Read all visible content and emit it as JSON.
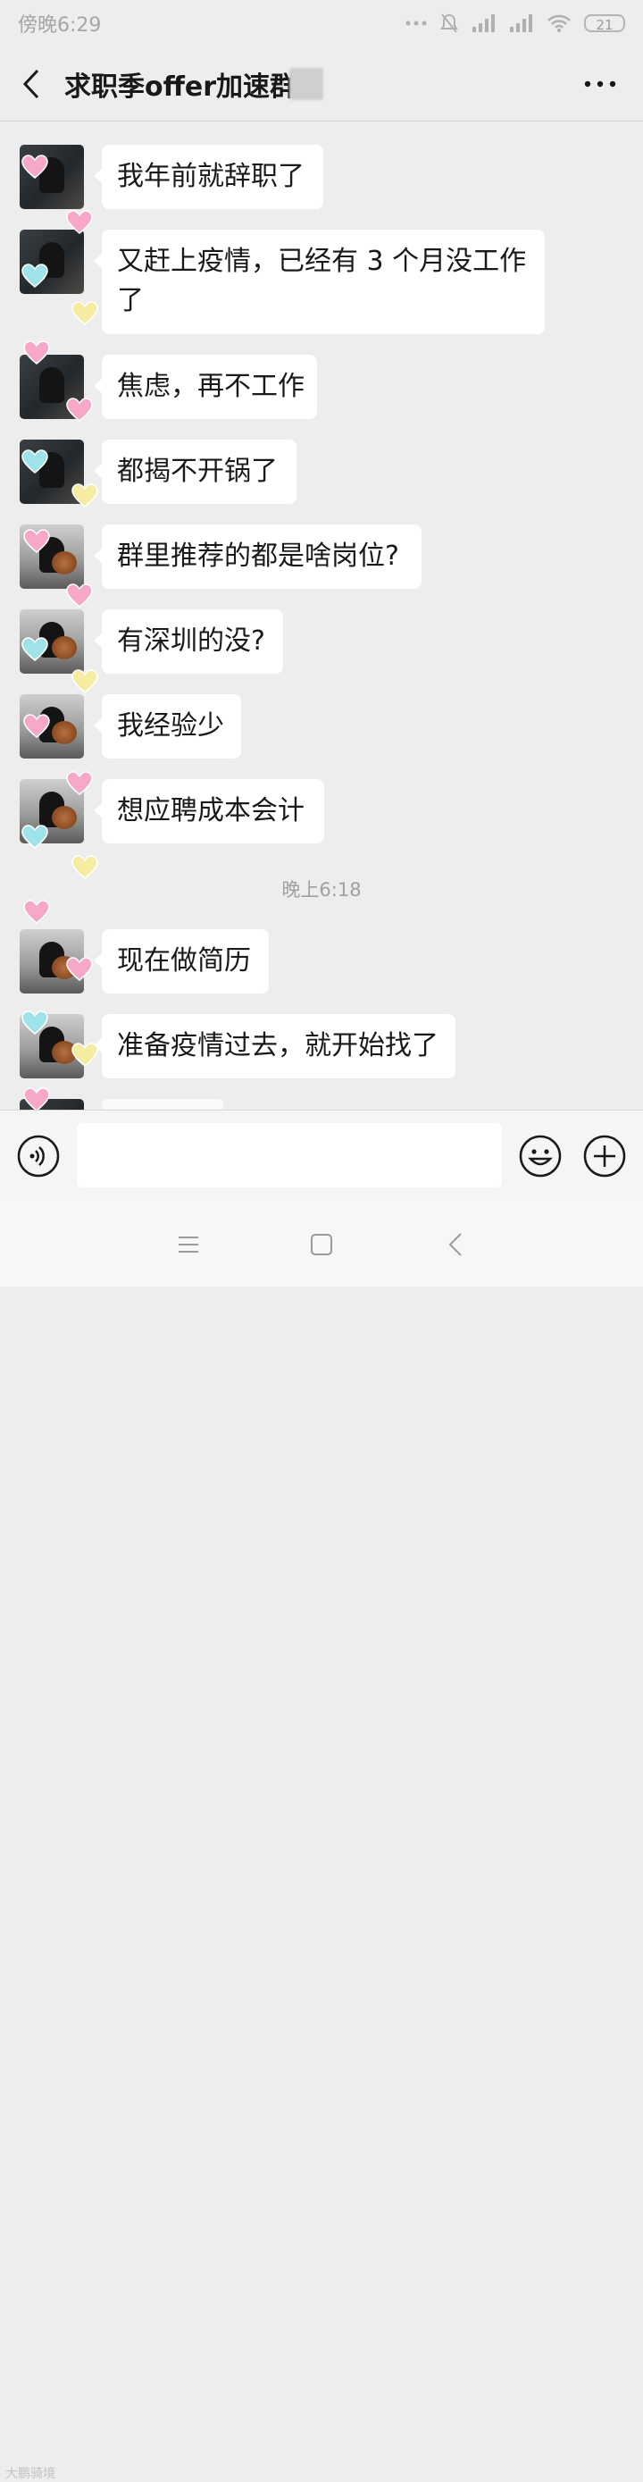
{
  "status_bar": {
    "time": "傍晚6:29",
    "battery": "21"
  },
  "header": {
    "title": "求职季offer加速群"
  },
  "messages": [
    {
      "text": "我年前就辞职了",
      "avatar": "dark"
    },
    {
      "text": "又赶上疫情，已经有 3 个月没工作了",
      "avatar": "dark"
    },
    {
      "text": "焦虑，再不工作",
      "avatar": "dark"
    },
    {
      "text": "都揭不开锅了",
      "avatar": "dark"
    },
    {
      "text": "群里推荐的都是啥岗位?",
      "avatar": "light"
    },
    {
      "text": "有深圳的没?",
      "avatar": "light"
    },
    {
      "text": "我经验少",
      "avatar": "light"
    },
    {
      "text": "想应聘成本会计",
      "avatar": "light"
    },
    {
      "text": "现在做简历",
      "avatar": "light"
    },
    {
      "text": "准备疫情过去，就开始找了",
      "avatar": "light"
    }
  ],
  "timestamp": "晚上6:18",
  "input": {
    "value": "",
    "placeholder": ""
  },
  "watermark": "大鹏骑境",
  "colors": {
    "background": "#ededed",
    "bubble": "#ffffff",
    "heart_pink": "#f7a8c9",
    "heart_cyan": "#9fe3ea",
    "heart_yellow": "#f4eca0"
  },
  "icons": [
    "back-icon",
    "more-icon",
    "voice-icon",
    "emoji-icon",
    "plus-icon",
    "menu-icon",
    "home-icon",
    "nav-back-icon",
    "heart-icon"
  ]
}
